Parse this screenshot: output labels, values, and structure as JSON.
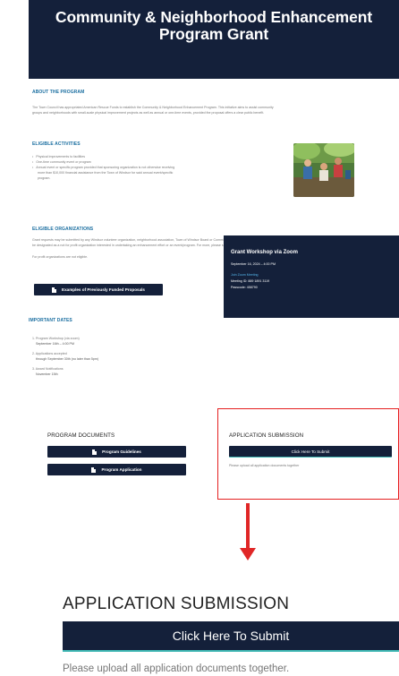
{
  "header": {
    "title_line1": "Community & Neighborhood Enhancement",
    "title_line2": "Program Grant"
  },
  "about": {
    "title": "ABOUT THE PROGRAM",
    "text_line1": "The Town Council has appropriated American Rescue Funds to establish the Community & Neighborhood Enhancement Program. This initiative aims to assist community",
    "text_line2": "groups and neighborhoods with small-scale physical improvement projects as well as annual or one-time events, provided the proposal offers a clear public benefit."
  },
  "activities": {
    "title": "ELIGIBLE ACTIVITIES",
    "items": [
      "Physical improvements to facilities",
      "One-time community event or program",
      "Annual event or specific program provided that sponsoring organization is not otherwise receiving",
      "more than $10,000 financial assistance from the Town of Windsor for said annual event/specific",
      "program."
    ]
  },
  "organizations": {
    "title": "ELIGIBLE ORGANIZATIONS",
    "text_line1": "Grant requests may be submitted by any Windsor volunteer organization, neighborhood association, Town of Windsor Board or Commission, or group that does not need to",
    "text_line2": "be designated as a not for profit organization interested in undertaking an enhancement effort or an event/program. For more, please see the program guidelines.",
    "note": "For profit organizations are not eligible.",
    "examples_button": "Examples of Previously Funded Proposals"
  },
  "dates": {
    "title": "IMPORTANT DATES",
    "items": [
      {
        "label": "1. Program Workshop (via zoom)",
        "value": "September 16th – 4:00 PM"
      },
      {
        "label": "2. Applications accepted",
        "value": "through September 30th (no later than 5pm)"
      },
      {
        "label": "3. Award Notifications",
        "value": "November 15th"
      }
    ]
  },
  "workshop": {
    "title": "Grant Workshop via Zoom",
    "date": "September 16, 2024 – 4:00 PM",
    "link": "Join Zoom Meeting",
    "meeting_id": "Meeting ID: 889 1891 3119",
    "passcode": "Passcode: 458790"
  },
  "documents": {
    "title": "PROGRAM DOCUMENTS",
    "guidelines_button": "Program Guidelines",
    "application_button": "Program Application"
  },
  "submission": {
    "title": "APPLICATION SUBMISSION",
    "button": "Click Here To Submit",
    "note_small": "Please upload all application documents together",
    "note": "Please upload all application documents together."
  },
  "colors": {
    "navy": "#14203a",
    "accent_blue": "#1a6ea0",
    "highlight_red": "#e52020",
    "teal": "#3fb7b3"
  },
  "icons": [
    "document-icon",
    "down-arrow-icon"
  ]
}
